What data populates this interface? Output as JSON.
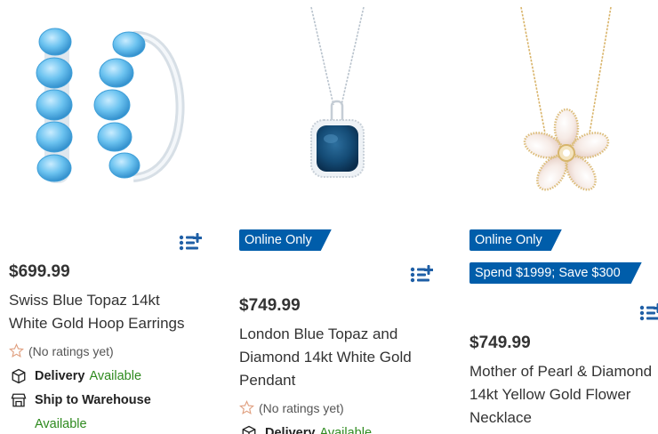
{
  "colors": {
    "brand_blue": "#005daa",
    "available_green": "#2e8a1e",
    "star_outline": "#e0a080"
  },
  "products": [
    {
      "price": "$699.99",
      "name_line1": "Swiss Blue Topaz 14kt",
      "name_line2": "White Gold Hoop Earrings",
      "rating_text": "(No ratings yet)",
      "delivery_label": "Delivery",
      "delivery_status": "Available",
      "ship_label": "Ship to Warehouse",
      "ship_status": "Available"
    },
    {
      "badge": "Online Only",
      "price": "$749.99",
      "name_line1": "London Blue Topaz and",
      "name_line2": "Diamond 14kt White Gold",
      "name_line3": "Pendant",
      "rating_text": "(No ratings yet)",
      "delivery_label": "Delivery",
      "delivery_status": "Available"
    },
    {
      "badge": "Online Only",
      "promo": "Spend $1999; Save $300",
      "price": "$749.99",
      "name_line1": "Mother of Pearl & Diamond",
      "name_line2": "14kt Yellow Gold Flower",
      "name_line3": "Necklace"
    }
  ]
}
